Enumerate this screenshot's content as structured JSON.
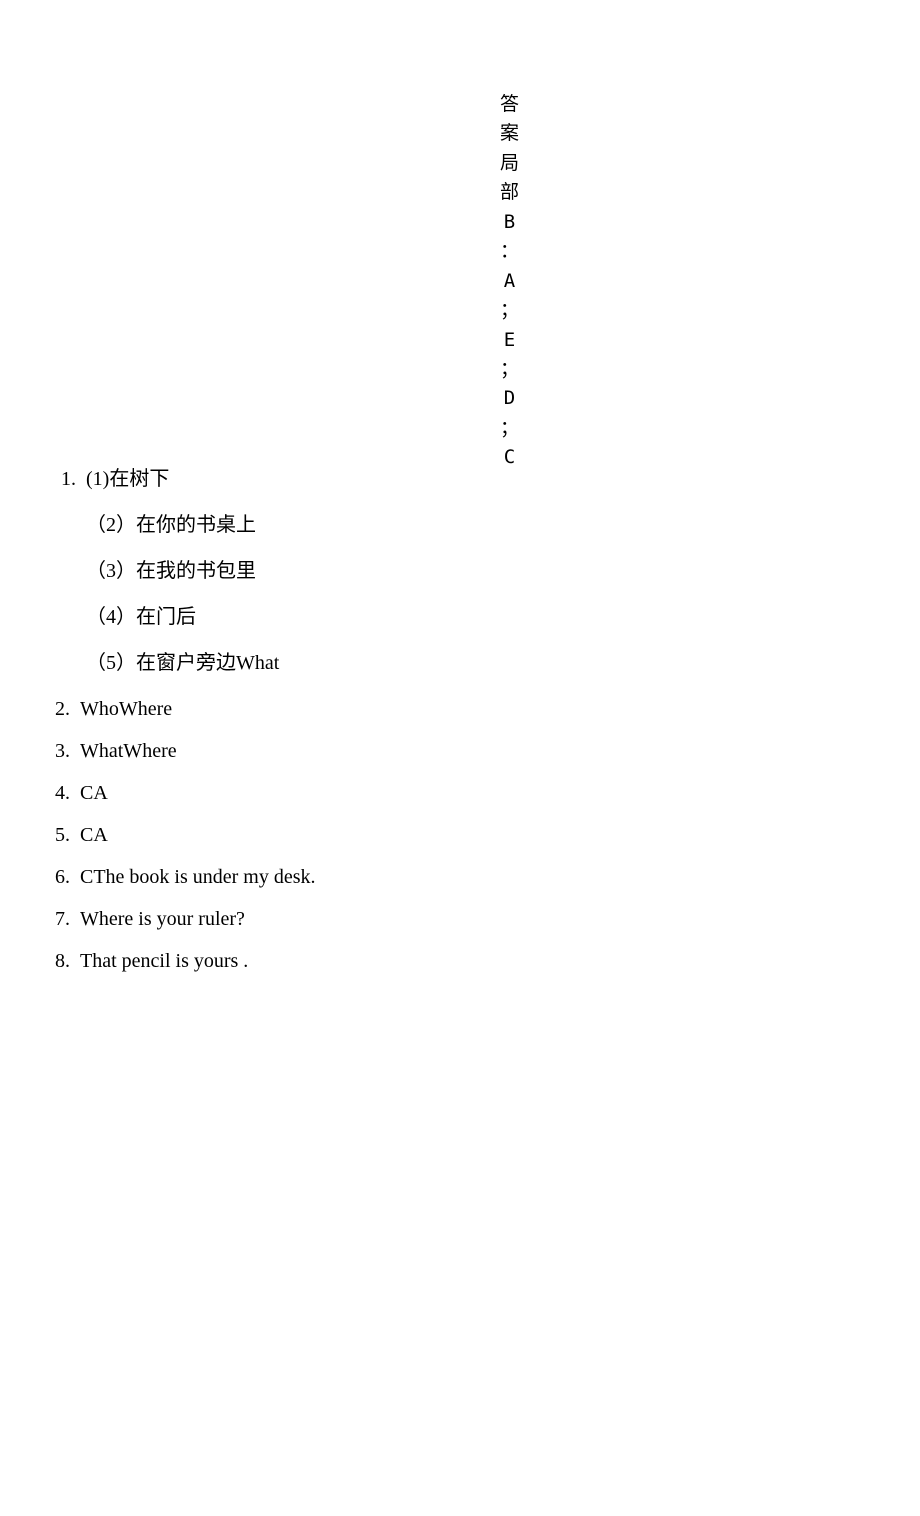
{
  "vertical_header": [
    "答",
    "案",
    "局",
    "部",
    "B",
    "：",
    "A",
    "；",
    "E",
    "；",
    "D",
    "；",
    "C"
  ],
  "answers": {
    "item1": {
      "number": "1.",
      "first_line": "(1)在树下",
      "sub2": "（2）在你的书桌上",
      "sub3": "（3）在我的书包里",
      "sub4": "（4）在门后",
      "sub5": "（5）在窗户旁边What"
    },
    "item2": {
      "number": "2.",
      "text": "WhoWhere"
    },
    "item3": {
      "number": "3.",
      "text": "WhatWhere"
    },
    "item4": {
      "number": "4.",
      "text": "CA"
    },
    "item5": {
      "number": "5.",
      "text": " CA"
    },
    "item6": {
      "number": "6.",
      "text": " CThe book is under my desk."
    },
    "item7": {
      "number": "7.",
      "text": " Where is your ruler?"
    },
    "item8": {
      "number": "8.",
      "text": " That pencil is yours ."
    }
  }
}
